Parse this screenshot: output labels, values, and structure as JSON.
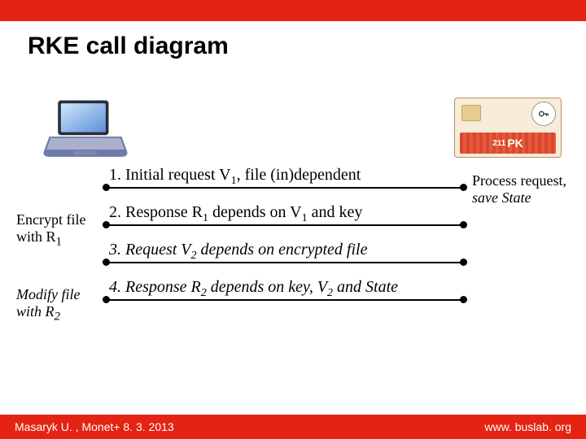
{
  "title": "RKE call diagram",
  "card_brand_prefix": "211",
  "card_brand_suffix": "PK",
  "messages": [
    {
      "html": "1. Initial request V<sub>1</sub>, file (in)dependent",
      "italic": false
    },
    {
      "html": "2. Response R<sub>1</sub> depends on V<sub>1</sub> and key",
      "italic": false
    },
    {
      "html": "3. Request V<sub>2</sub>  depends on encrypted file",
      "italic": true
    },
    {
      "html": "4. Response R<sub>2</sub> depends on key, V<sub>2</sub> and State",
      "italic": true
    }
  ],
  "right_note_line1": "Process request,",
  "right_note_line2": "save State",
  "left_note1_line1": "Encrypt file",
  "left_note1_line2": "with R",
  "left_note1_sub": "1",
  "left_note2_line1": "Modify file",
  "left_note2_line2": "with R",
  "left_note2_sub": "2",
  "footer_left": "Masaryk U. , Monet+ 8. 3. 2013",
  "footer_right": "www. buslab. org"
}
